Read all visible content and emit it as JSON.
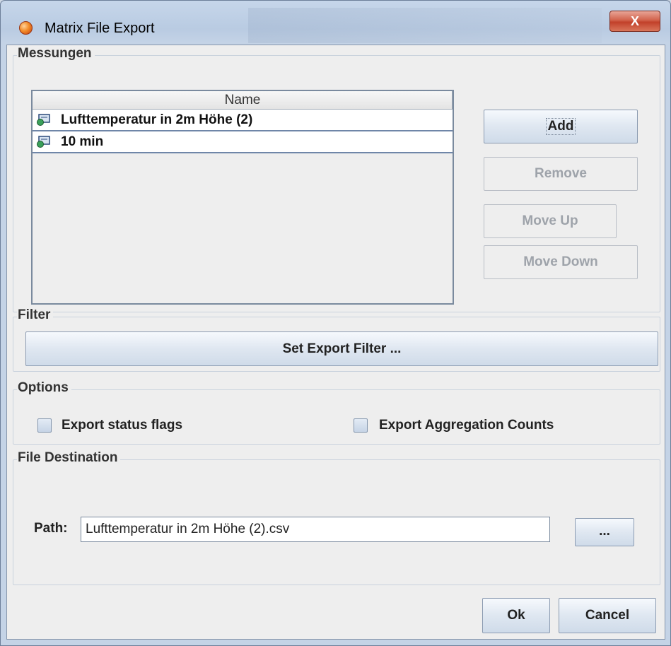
{
  "window": {
    "title": "Matrix File Export",
    "close_label": "X"
  },
  "messungen": {
    "legend": "Messungen",
    "column_header": "Name",
    "rows": [
      {
        "label": "Lufttemperatur in 2m Höhe (2)"
      },
      {
        "label": "10 min"
      }
    ],
    "buttons": {
      "add": "Add",
      "remove": "Remove",
      "move_up": "Move Up",
      "move_down": "Move Down"
    }
  },
  "filter": {
    "legend": "Filter",
    "button": "Set Export Filter ..."
  },
  "options": {
    "legend": "Options",
    "status_flags": {
      "label": "Export status flags",
      "checked": false
    },
    "aggregation_counts": {
      "label": "Export Aggregation Counts",
      "checked": false
    }
  },
  "destination": {
    "legend": "File Destination",
    "path_label": "Path:",
    "path_value": "Lufttemperatur in 2m Höhe (2).csv",
    "browse_label": "..."
  },
  "footer": {
    "ok": "Ok",
    "cancel": "Cancel"
  },
  "colors": {
    "titlebar": "#b9cbe2",
    "client_bg": "#eeeeee",
    "close_button": "#c2402a",
    "row_border": "#6f86a8"
  },
  "icons": {
    "title": "app-globe-icon",
    "row": "measurement-series-icon"
  }
}
